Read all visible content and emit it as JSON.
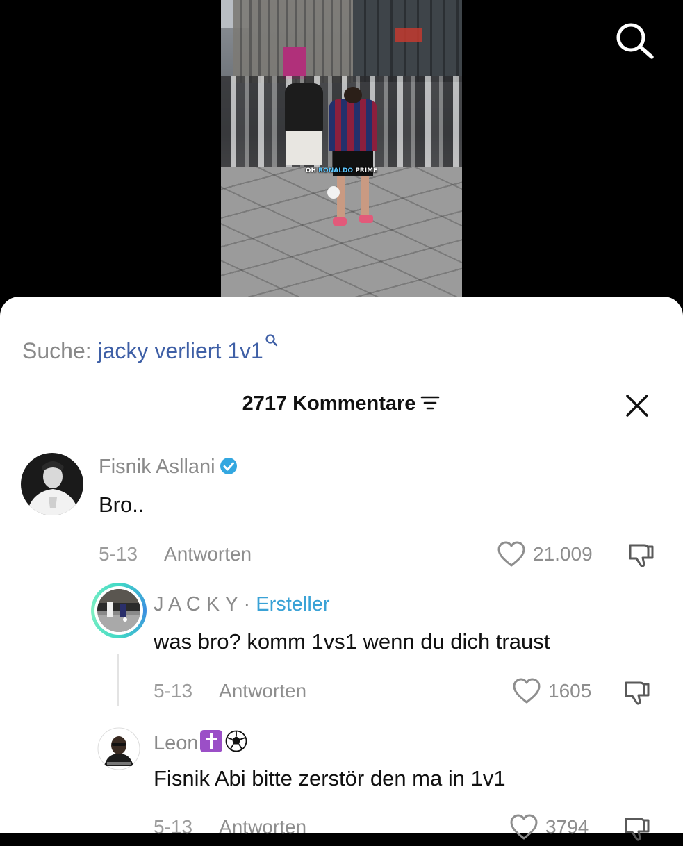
{
  "video": {
    "caption_part1": "OH ",
    "caption_highlight": "RONALDO",
    "caption_part2": " PRIME"
  },
  "search": {
    "prefix": "Suche: ",
    "query": "jacky verliert 1v1"
  },
  "comments_header": {
    "count": "2717",
    "label": " Kommentare"
  },
  "comments": [
    {
      "username": "Fisnik Asllani",
      "verified": true,
      "text": "Bro..",
      "date": "5-13",
      "reply_label": "Antworten",
      "likes": "21.009"
    },
    {
      "username": "J A C K Y",
      "separator": " · ",
      "creator_label": "Ersteller",
      "text": "was bro? komm 1vs1 wenn du dich traust",
      "date": "5-13",
      "reply_label": "Antworten",
      "likes": "1605"
    },
    {
      "username": "Leon",
      "emojis": "✝️⚽",
      "text": "Fisnik Abi bitte zerstör den ma in 1v1",
      "date": "5-13",
      "reply_label": "Antworten",
      "likes": "3794"
    }
  ],
  "colors": {
    "query": "#3e5fa6",
    "creator": "#3aa2d6",
    "verified": "#33a7e0",
    "muted": "#8a8a8a"
  },
  "icons": [
    "search-icon",
    "filter-icon",
    "close-icon",
    "verified-icon",
    "heart-icon",
    "dislike-icon"
  ]
}
